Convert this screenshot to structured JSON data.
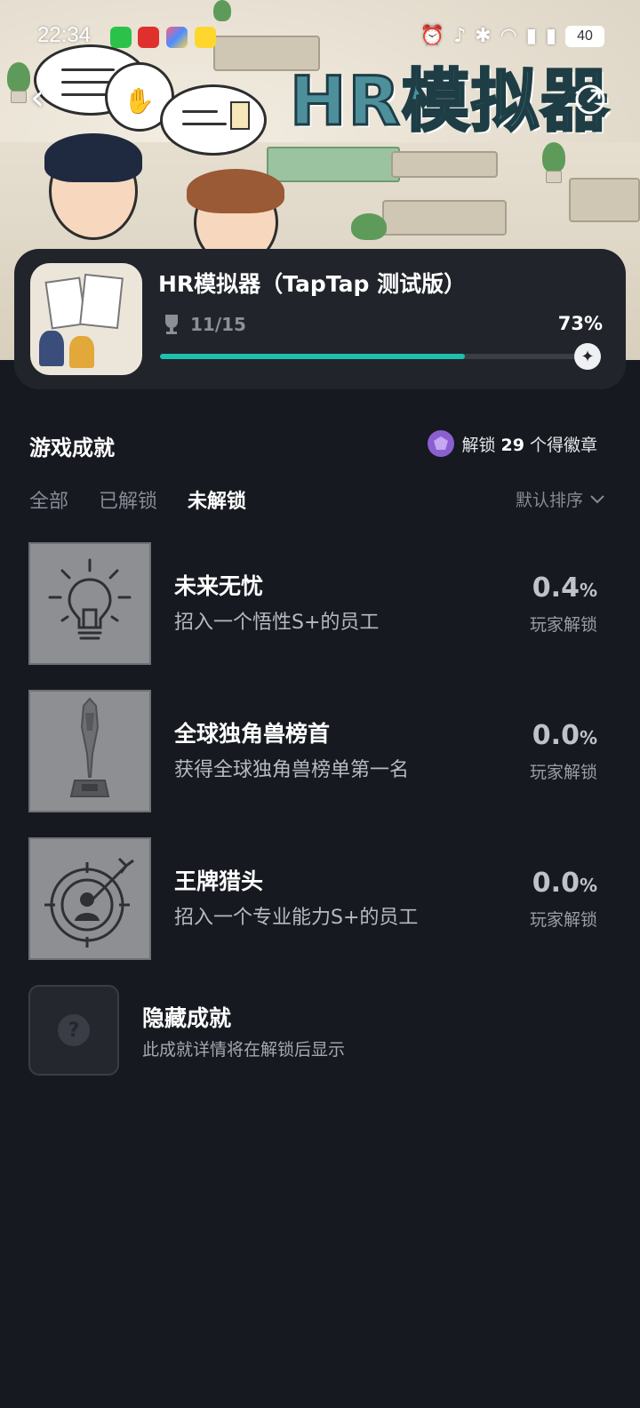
{
  "status_bar": {
    "time": "22:34",
    "battery": "40",
    "app_icons": [
      "wechat-icon",
      "netease-music-icon",
      "photos-icon",
      "mango-icon"
    ],
    "system_icons": [
      "alarm-icon",
      "mute-icon",
      "bluetooth-icon",
      "wifi-icon",
      "5g-signal-icon",
      "5g-signal-icon"
    ]
  },
  "hero": {
    "banner_title": "HR模拟器"
  },
  "game": {
    "title": "HR模拟器（TapTap 测试版）",
    "trophy_count": "11/15",
    "progress_percent": "73%",
    "progress_value": 0.73
  },
  "achievements": {
    "section_title": "游戏成就",
    "badge_prefix": "解锁 ",
    "badge_count": "29",
    "badge_suffix": " 个得徽章",
    "tabs": [
      "全部",
      "已解锁",
      "未解锁"
    ],
    "active_tab": 2,
    "sort_label": "默认排序",
    "items": [
      {
        "name": "未来无忧",
        "desc": "招入一个悟性S+的员工",
        "pct": "0.4",
        "pct_sign": "%",
        "pct_label": "玩家解锁",
        "icon": "lightbulb-icon"
      },
      {
        "name": "全球独角兽榜首",
        "desc": "获得全球独角兽榜单第一名",
        "pct": "0.0",
        "pct_sign": "%",
        "pct_label": "玩家解锁",
        "icon": "trophy-icon"
      },
      {
        "name": "王牌猎头",
        "desc": "招入一个专业能力S+的员工",
        "pct": "0.0",
        "pct_sign": "%",
        "pct_label": "玩家解锁",
        "icon": "target-person-icon"
      }
    ],
    "hidden": {
      "name": "隐藏成就",
      "desc": "此成就详情将在解锁后显示",
      "glyph": "?"
    }
  },
  "colors": {
    "background": "#161920",
    "card": "#21242b",
    "accent": "#1fbfb0",
    "badge": "#8b5fd0"
  }
}
